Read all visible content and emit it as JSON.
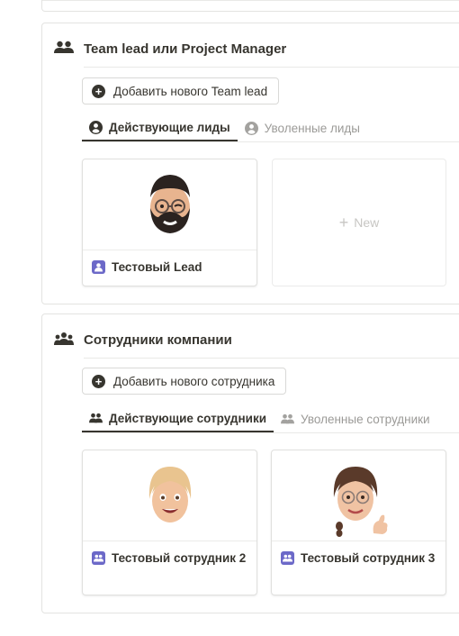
{
  "team_lead_section": {
    "title": "Team lead или Project Manager",
    "add_button": "Добавить нового Team lead",
    "tabs": [
      {
        "label": "Действующие лиды",
        "active": true
      },
      {
        "label": "Уволенные лиды",
        "active": false
      }
    ],
    "cards": [
      {
        "name": "Тестовый Lead",
        "avatar": "memoji-bearded-man-glasses-wink"
      }
    ],
    "new_card_label": "New"
  },
  "employees_section": {
    "title": "Сотрудники компании",
    "add_button": "Добавить нового сотрудника",
    "tabs": [
      {
        "label": "Действующие сотрудники",
        "active": true
      },
      {
        "label": "Уволенные сотрудники",
        "active": false
      }
    ],
    "cards": [
      {
        "name": "Тестовый сотрудник 2",
        "avatar": "memoji-blonde-woman"
      },
      {
        "name": "Тестовый сотрудник 3",
        "avatar": "memoji-braided-woman-thumbs-up"
      }
    ]
  },
  "colors": {
    "accent": "#37352f",
    "muted": "#9b9a97",
    "badge": "#6c69c8",
    "border": "#e3e3e1"
  }
}
